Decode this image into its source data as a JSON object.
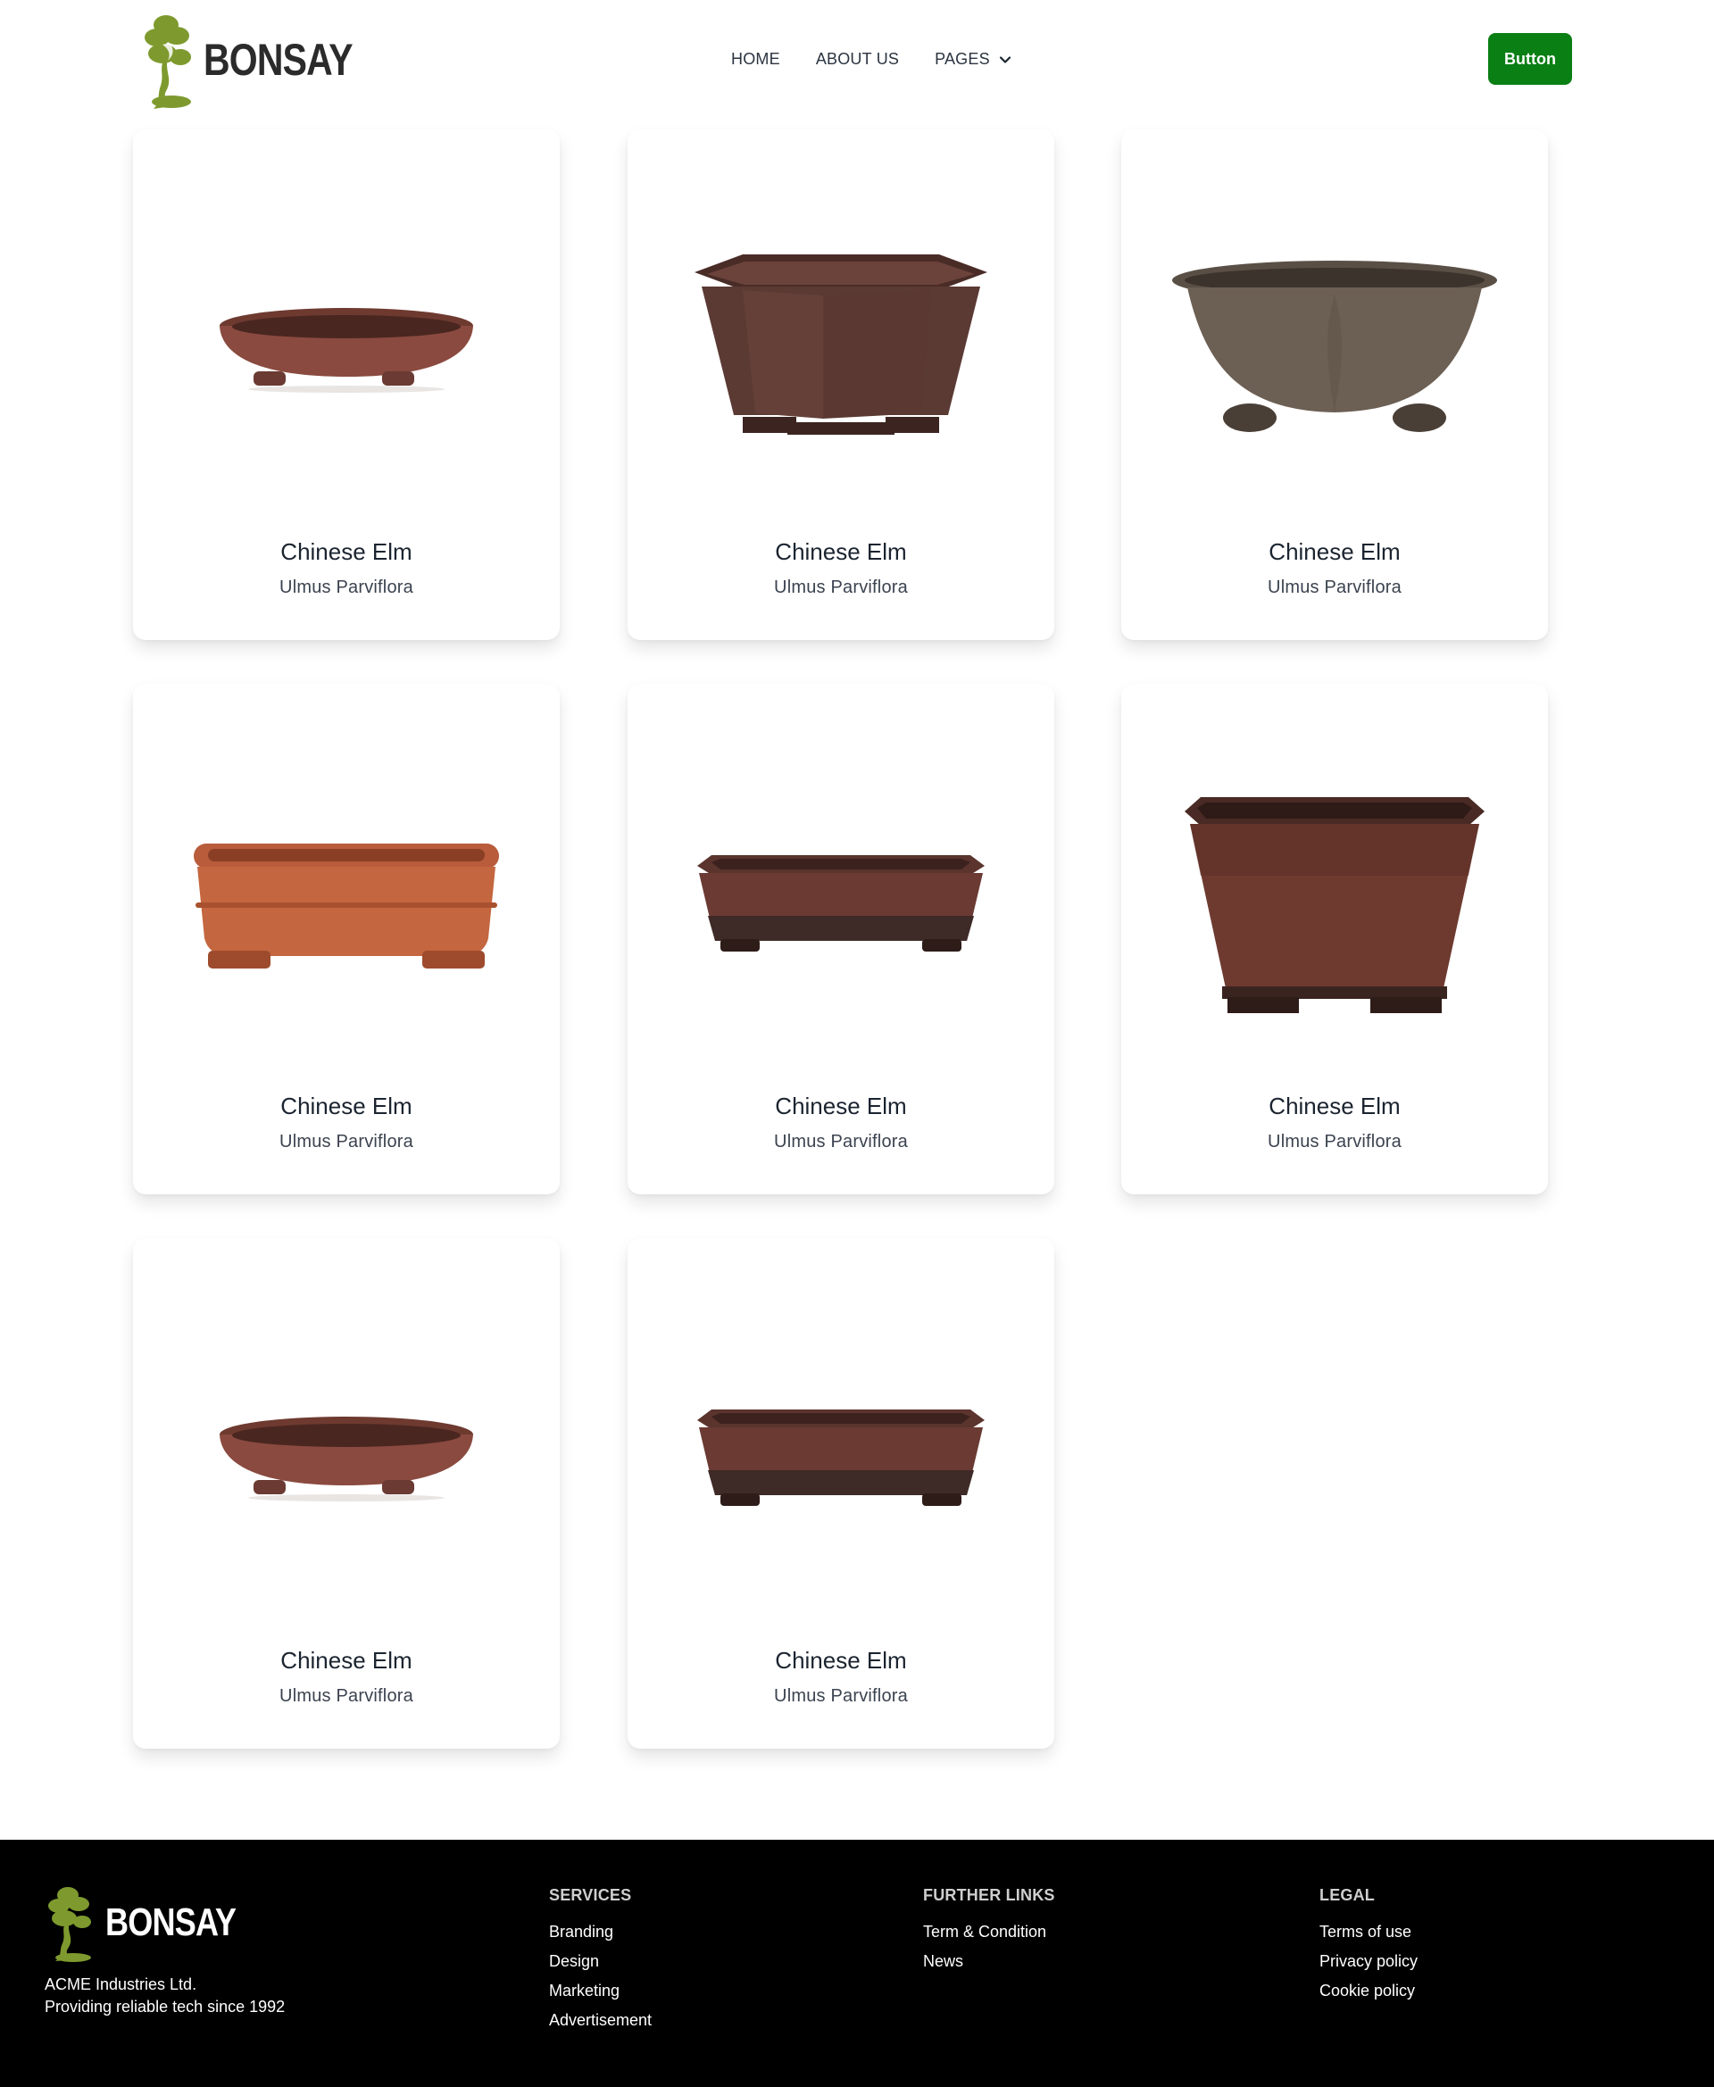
{
  "brand": {
    "name": "BONSAY",
    "color_green": "#7e9a2e",
    "accent_button": "#0a7f14"
  },
  "nav": {
    "items": [
      {
        "label": "HOME"
      },
      {
        "label": "ABOUT US"
      },
      {
        "label": "PAGES",
        "icon": "chevron-down-icon"
      }
    ],
    "button_label": "Button"
  },
  "products": [
    {
      "name": "Chinese Elm",
      "latin": "Ulmus Parviflora",
      "pot": "round-shallow",
      "color": "#8a4a3f"
    },
    {
      "name": "Chinese Elm",
      "latin": "Ulmus Parviflora",
      "pot": "hexagonal",
      "color": "#5a3a33"
    },
    {
      "name": "Chinese Elm",
      "latin": "Ulmus Parviflora",
      "pot": "lobed-grey",
      "color": "#6c5f53"
    },
    {
      "name": "Chinese Elm",
      "latin": "Ulmus Parviflora",
      "pot": "rect-orange",
      "color": "#b85c3c"
    },
    {
      "name": "Chinese Elm",
      "latin": "Ulmus Parviflora",
      "pot": "rect-shallow",
      "color": "#6a3a33"
    },
    {
      "name": "Chinese Elm",
      "latin": "Ulmus Parviflora",
      "pot": "square-deep",
      "color": "#6e3a30"
    },
    {
      "name": "Chinese Elm",
      "latin": "Ulmus Parviflora",
      "pot": "round-shallow",
      "color": "#8a4a3f"
    },
    {
      "name": "Chinese Elm",
      "latin": "Ulmus Parviflora",
      "pot": "rect-shallow",
      "color": "#6a3a33"
    }
  ],
  "footer": {
    "brand": "BONSAY",
    "company_line1": "ACME Industries Ltd.",
    "company_line2": "Providing reliable tech since 1992",
    "columns": [
      {
        "heading": "SERVICES",
        "links": [
          "Branding",
          "Design",
          "Marketing",
          "Advertisement"
        ]
      },
      {
        "heading": "FURTHER LINKS",
        "links": [
          "Term & Condition",
          "News"
        ]
      },
      {
        "heading": "LEGAL",
        "links": [
          "Terms of use",
          "Privacy policy",
          "Cookie policy"
        ]
      }
    ]
  }
}
